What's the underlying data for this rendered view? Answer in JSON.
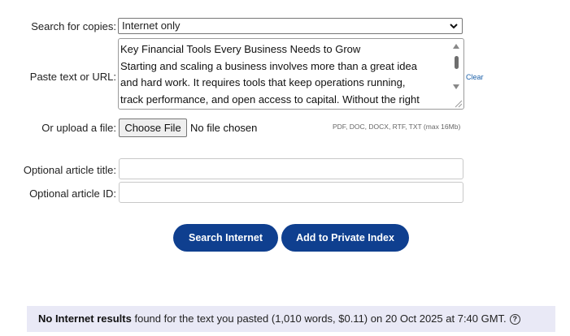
{
  "search_copies": {
    "label": "Search for copies:",
    "selected": "Internet only",
    "icon": "chevron-down-icon"
  },
  "paste": {
    "label": "Paste text or URL:",
    "lines": [
      "Key Financial Tools Every Business Needs to Grow",
      "Starting and scaling a business involves more than a great idea",
      "and hard work. It requires tools that keep operations running,",
      "track performance, and open access to capital. Without the right"
    ],
    "clear_label": "Clear"
  },
  "upload": {
    "label": "Or upload a file:",
    "button_label": "Choose File",
    "status": "No file chosen",
    "hint": "PDF, DOC, DOCX, RTF, TXT (max 16Mb)"
  },
  "article_title": {
    "label": "Optional article title:",
    "value": ""
  },
  "article_id": {
    "label": "Optional article ID:",
    "value": ""
  },
  "buttons": {
    "search_internet": "Search Internet",
    "add_private": "Add to Private Index"
  },
  "result": {
    "bold": "No Internet results",
    "text": " found for the text you pasted (1,010 words, $0.11) on 20 Oct 2025 at 7:40 GMT.",
    "help_icon": "question-circle-icon"
  },
  "colors": {
    "primary_button": "#0f3f8f",
    "result_bg": "#e9e9f6",
    "link": "#1a5fa8"
  }
}
